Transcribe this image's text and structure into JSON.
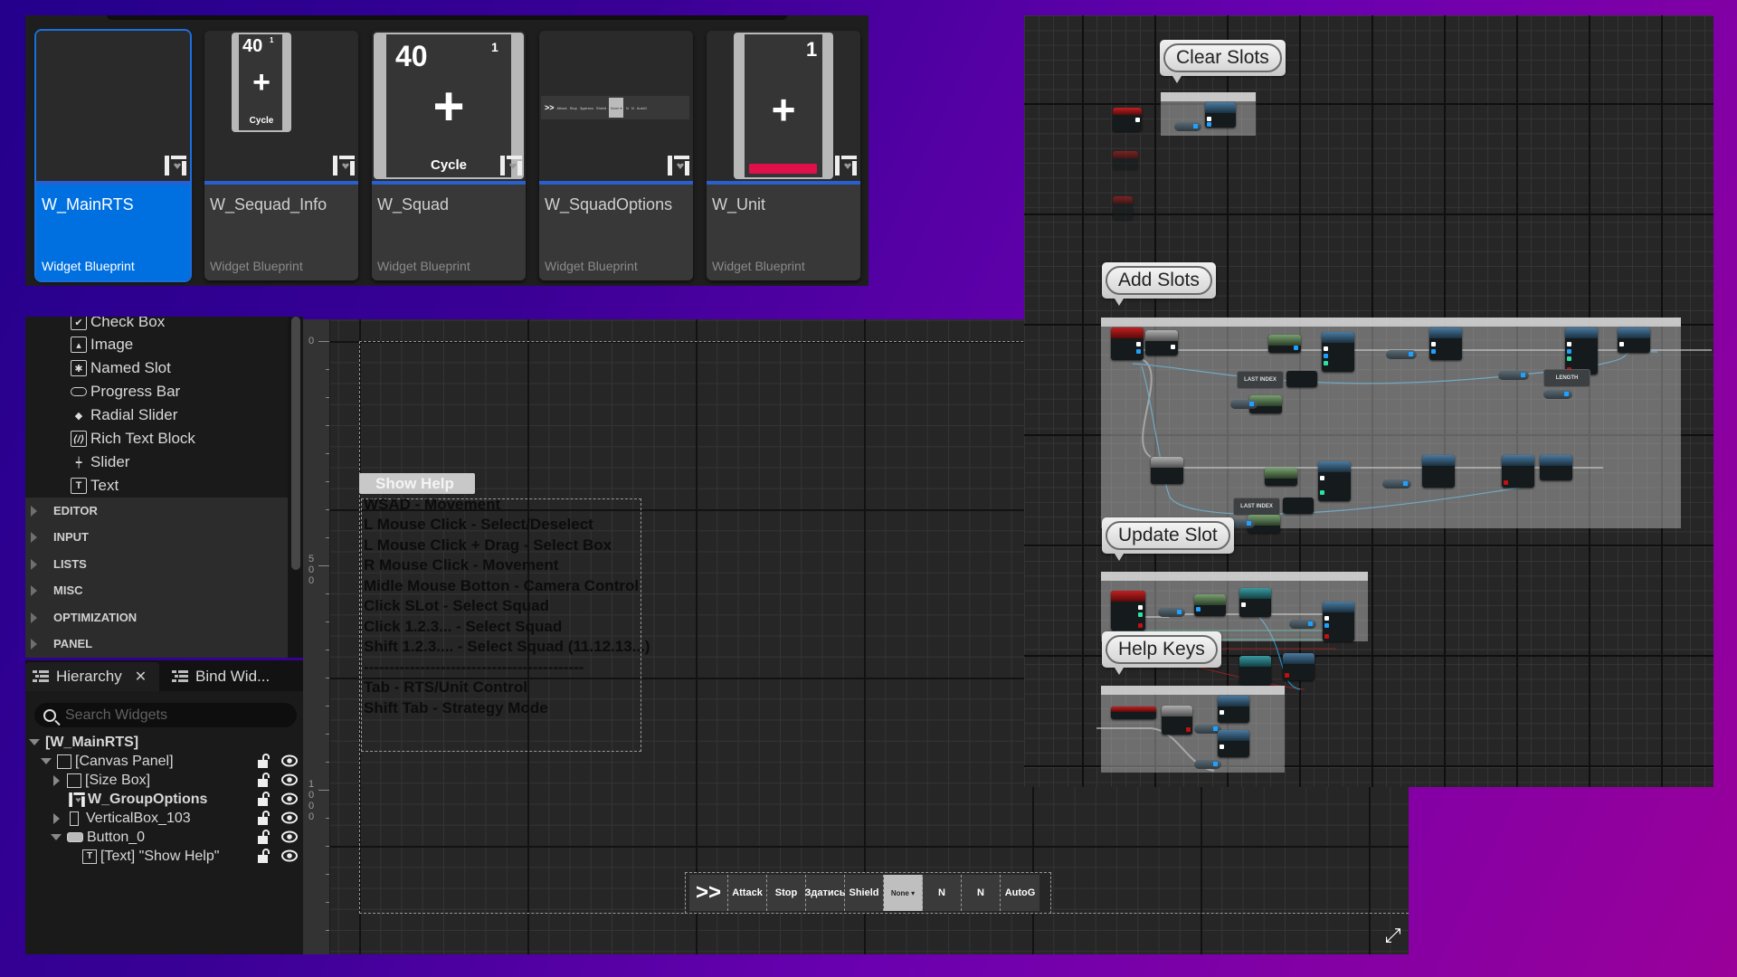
{
  "content_browser": {
    "cards": [
      {
        "name": "W_MainRTS",
        "type": "Widget Blueprint",
        "selected": true,
        "thumbnail": "empty"
      },
      {
        "name": "W_Sequad_Info",
        "type": "Widget Blueprint",
        "selected": false,
        "thumbnail": "slot-small",
        "thumb_count": "40",
        "thumb_index": "1",
        "thumb_caption": "Cycle"
      },
      {
        "name": "W_Squad",
        "type": "Widget Blueprint",
        "selected": false,
        "thumbnail": "slot-large",
        "thumb_count": "40",
        "thumb_index": "1",
        "thumb_caption": "Cycle"
      },
      {
        "name": "W_SquadOptions",
        "type": "Widget Blueprint",
        "selected": false,
        "thumbnail": "toolbar"
      },
      {
        "name": "W_Unit",
        "type": "Widget Blueprint",
        "selected": false,
        "thumbnail": "unit",
        "thumb_index": "1",
        "health_bar_color": "#e0104a"
      }
    ]
  },
  "palette": {
    "items": [
      {
        "label": "Check Box",
        "icon": "checkbox-icon"
      },
      {
        "label": "Image",
        "icon": "image-icon"
      },
      {
        "label": "Named Slot",
        "icon": "named-slot-icon"
      },
      {
        "label": "Progress Bar",
        "icon": "progress-bar-icon"
      },
      {
        "label": "Radial Slider",
        "icon": "radial-slider-icon"
      },
      {
        "label": "Rich Text Block",
        "icon": "rich-text-icon"
      },
      {
        "label": "Slider",
        "icon": "slider-icon"
      },
      {
        "label": "Text",
        "icon": "text-icon"
      }
    ],
    "categories": [
      "EDITOR",
      "INPUT",
      "LISTS",
      "MISC",
      "OPTIMIZATION",
      "PANEL"
    ]
  },
  "hierarchy": {
    "tabs": [
      {
        "label": "Hierarchy",
        "active": true,
        "closable": true
      },
      {
        "label": "Bind Wid...",
        "active": false,
        "closable": false
      }
    ],
    "search_placeholder": "Search Widgets",
    "tree": [
      {
        "label": "[W_MainRTS]",
        "depth": 0,
        "expander": "down",
        "bold": true,
        "icon": null
      },
      {
        "label": "[Canvas Panel]",
        "depth": 1,
        "expander": "down",
        "bold": false,
        "icon": "canvas-panel-icon"
      },
      {
        "label": "[Size Box]",
        "depth": 2,
        "expander": "right",
        "bold": false,
        "icon": "size-box-icon"
      },
      {
        "label": "W_GroupOptions",
        "depth": 2,
        "expander": "none",
        "bold": true,
        "icon": "user-widget-icon"
      },
      {
        "label": "VerticalBox_103",
        "depth": 2,
        "expander": "right",
        "bold": false,
        "icon": "vertical-box-icon"
      },
      {
        "label": "Button_0",
        "depth": 2,
        "expander": "down",
        "bold": false,
        "icon": "button-icon"
      },
      {
        "label": "[Text] \"Show Help\"",
        "depth": 3,
        "expander": "none",
        "bold": false,
        "icon": "text-icon"
      }
    ]
  },
  "designer": {
    "ruler_labels": [
      "0",
      "500",
      "1000"
    ],
    "show_help_label": "Show Help",
    "help_lines": [
      "WSAD - Movement",
      "L Mouse Click - Select/Deselect",
      "L Mouse Click + Drag - Select Box",
      "R Mouse Click - Movement",
      "Midle Mouse Botton - Camera Control",
      "Click SLot - Select Squad",
      "Click 1.2.3... - Select Squad",
      "Shift 1.2.3.... - Select Squad (11.12.13...)",
      "-------------------------------------------",
      "Tab - RTS/Unit Control",
      "Shift Tab - Strategy Mode"
    ],
    "squad_toolbar": [
      {
        "label": ">>",
        "kind": "chevron"
      },
      {
        "label": "Attack",
        "kind": "button"
      },
      {
        "label": "Stop",
        "kind": "button"
      },
      {
        "label": "Здатись",
        "kind": "button"
      },
      {
        "label": "Shield",
        "kind": "button"
      },
      {
        "label": "None ▾",
        "kind": "dropdown"
      },
      {
        "label": "N",
        "kind": "button"
      },
      {
        "label": "N",
        "kind": "button"
      },
      {
        "label": "AutoG",
        "kind": "button"
      }
    ]
  },
  "event_graph": {
    "comments": [
      {
        "title": "Clear Slots"
      },
      {
        "title": "Add Slots"
      },
      {
        "title": "Update Slot"
      },
      {
        "title": "Help Keys"
      }
    ],
    "macro_labels": [
      "LAST INDEX",
      "LENGTH",
      "LAST INDEX"
    ]
  }
}
